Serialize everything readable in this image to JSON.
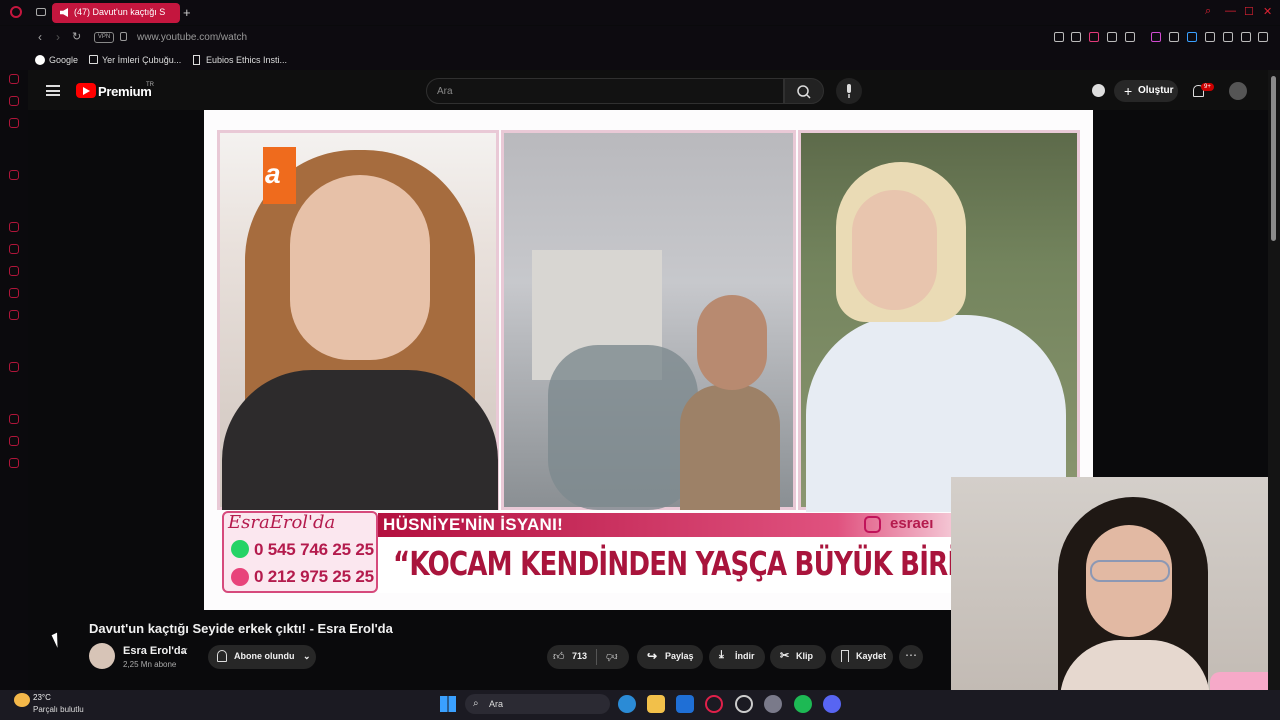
{
  "browser": {
    "tab_title": "(47) Davut'un kaçtığı S",
    "new_tab": "+",
    "url": "www.youtube.com/watch",
    "vpn_label": "VPN",
    "bookmarks": [
      "Google",
      "Yer İmleri Çubuğu...",
      "Eubios Ethics Insti..."
    ]
  },
  "youtube": {
    "brand": "Premium",
    "brand_region": "TR",
    "search_placeholder": "Ara",
    "create_label": "Oluştur",
    "notification_count": "9+"
  },
  "video": {
    "title": "Davut'un kaçtığı Seyide erkek çıktı! - Esra Erol'da",
    "channel": "Esra Erol'da",
    "verified": "✔",
    "subscribers": "2,25 Mn abone",
    "subscribe_label": "Abone olundu",
    "like_count": "713",
    "share_label": "Paylaş",
    "download_label": "İndir",
    "clip_label": "Klip",
    "save_label": "Kaydet",
    "more": "⋯"
  },
  "overlay": {
    "logo_text": "a",
    "brand_script": "EsraErol'da",
    "phone1": "0 545 746 25 25",
    "phone2": "0 212 975 25 25",
    "banner_title": "HÜSNİYE'NİN İSYANI!",
    "instagram": "esraeı",
    "quote": "“KOCAM KENDİNDEN YAŞÇA BÜYÜK BİRİNE"
  },
  "taskbar": {
    "temperature": "23°C",
    "weather_desc": "Parçalı bulutlu",
    "search_label": "Ara"
  },
  "colors": {
    "tab_red": "#c4163e",
    "youtube_red": "#ff0000",
    "banner_pink": "#b3103f"
  }
}
